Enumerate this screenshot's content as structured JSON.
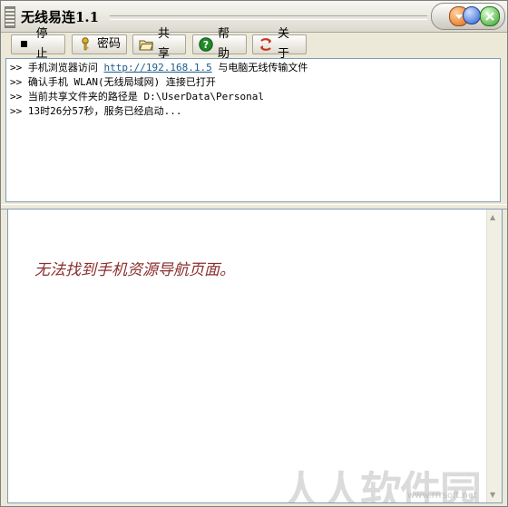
{
  "window": {
    "title": "无线易连1.1"
  },
  "toolbar": {
    "stop_label": "停止",
    "password_label": "密码",
    "share_label": "共享",
    "help_label": "帮助",
    "about_label": "关于"
  },
  "log": {
    "prefix": ">>",
    "lines": [
      {
        "text_before": "手机浏览器访问",
        "link": "http://192.168.1.5",
        "text_after": "与电脑无线传输文件"
      },
      {
        "text": "确认手机 WLAN(无线局域网) 连接已打开"
      },
      {
        "text": "当前共享文件夹的路径是 D:\\UserData\\Personal"
      },
      {
        "text": "13时26分57秒，服务已经启动..."
      }
    ]
  },
  "browser": {
    "message": "无法找到手机资源导航页面。"
  },
  "watermark": {
    "text": "人人软件园",
    "url": "www.rrrsoft.net"
  },
  "colors": {
    "message": "#8b2e2e",
    "link": "#1c5c8a"
  }
}
